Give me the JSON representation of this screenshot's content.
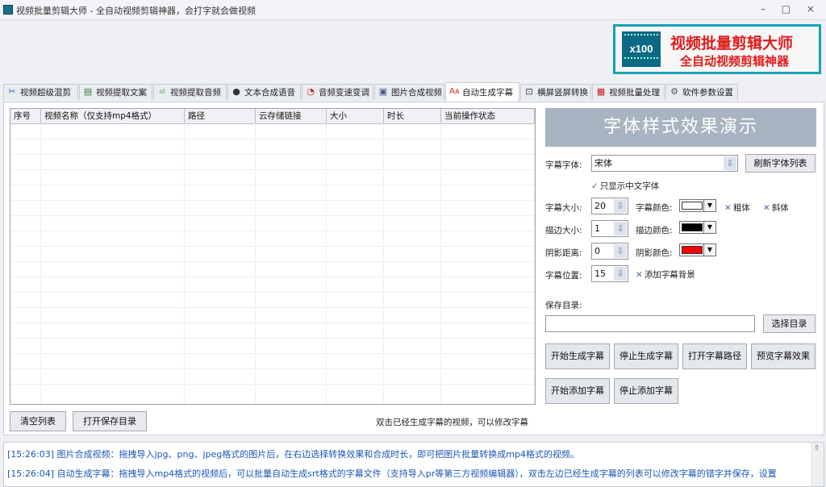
{
  "window": {
    "title": "视频批量剪辑大师 - 全自动视频剪辑神器，会打字就会做视频",
    "controls": "– □ ×"
  },
  "logo": {
    "badge": "x100",
    "line1": "视频批量剪辑大师",
    "line2": "全自动视频剪辑神器"
  },
  "tabs": [
    {
      "label": "视频超级混剪",
      "icon": "scissors-icon",
      "glyph": "✂"
    },
    {
      "label": "视频提取文案",
      "icon": "document-icon",
      "glyph": "▤"
    },
    {
      "label": "视频提取音频",
      "icon": "audio-wave-icon",
      "glyph": "ııl"
    },
    {
      "label": "文本合成语音",
      "icon": "microphone-icon",
      "glyph": "●"
    },
    {
      "label": "音频变速变调",
      "icon": "speedometer-icon",
      "glyph": "◔"
    },
    {
      "label": "图片合成视频",
      "icon": "image-icon",
      "glyph": "▣"
    },
    {
      "label": "自动生成字幕",
      "icon": "font-size-icon",
      "glyph": "Aᴀ"
    },
    {
      "label": "横屏竖屏转换",
      "icon": "rotate-screen-icon",
      "glyph": "⊡"
    },
    {
      "label": "视频批量处理",
      "icon": "film-icon",
      "glyph": "▦"
    },
    {
      "label": "软件参数设置",
      "icon": "gear-icon",
      "glyph": "⚙"
    }
  ],
  "active_tab": "自动生成字幕",
  "table": {
    "columns": [
      "序号",
      "视频名称（仅支持mp4格式）",
      "路径",
      "云存储链接",
      "大小",
      "时长",
      "当前操作状态"
    ],
    "rows": []
  },
  "buttons": {
    "clear_list": "清空列表",
    "open_save_dir": "打开保存目录",
    "refresh_fonts": "刷新字体列表",
    "choose_dir": "选择目录",
    "start_generate": "开始生成字幕",
    "stop_generate": "停止生成字幕",
    "open_subtitle_path": "打开字幕路径",
    "preview_effect": "预览字幕效果",
    "start_add": "开始添加字幕",
    "stop_add": "停止添加字幕"
  },
  "hint": "双击已经生成字幕的视频，可以修改字幕",
  "preview_title": "字体样式效果演示",
  "settings": {
    "font_label": "字幕字体:",
    "font_value": "宋体",
    "only_chinese": "只显示中文字体",
    "size_label": "字幕大小:",
    "size_value": "20",
    "color_label": "字幕颜色:",
    "color_value": "#ffffff",
    "bold": "粗体",
    "italic": "斜体",
    "stroke_label": "描边大小:",
    "stroke_value": "1",
    "stroke_color_label": "描边颜色:",
    "stroke_color_value": "#000000",
    "shadow_label": "阴影距离:",
    "shadow_value": "0",
    "shadow_color_label": "阴影颜色:",
    "shadow_color_value": "#ff0000",
    "position_label": "字幕位置:",
    "position_value": "15",
    "add_background": "添加字幕背景",
    "save_dir_label": "保存目录:",
    "save_dir_value": ""
  },
  "log": [
    "[15:26:03] 图片合成视频：拖拽导入jpg、png、jpeg格式的图片后，在右边选择转换效果和合成时长，即可把图片批量转换成mp4格式的视频。",
    "[15:26:04] 自动生成字幕：拖拽导入mp4格式的视频后，可以批量自动生成srt格式的字幕文件（支持导入pr等第三方视频编辑器），双击左边已经生成字幕的列表可以修改字幕的错字并保存，设置"
  ],
  "colors": {
    "accent": "#16a3b5",
    "brand_red": "#e01b1b",
    "log_text": "#1a56b5",
    "preview_bg": "#a9b4c2"
  }
}
